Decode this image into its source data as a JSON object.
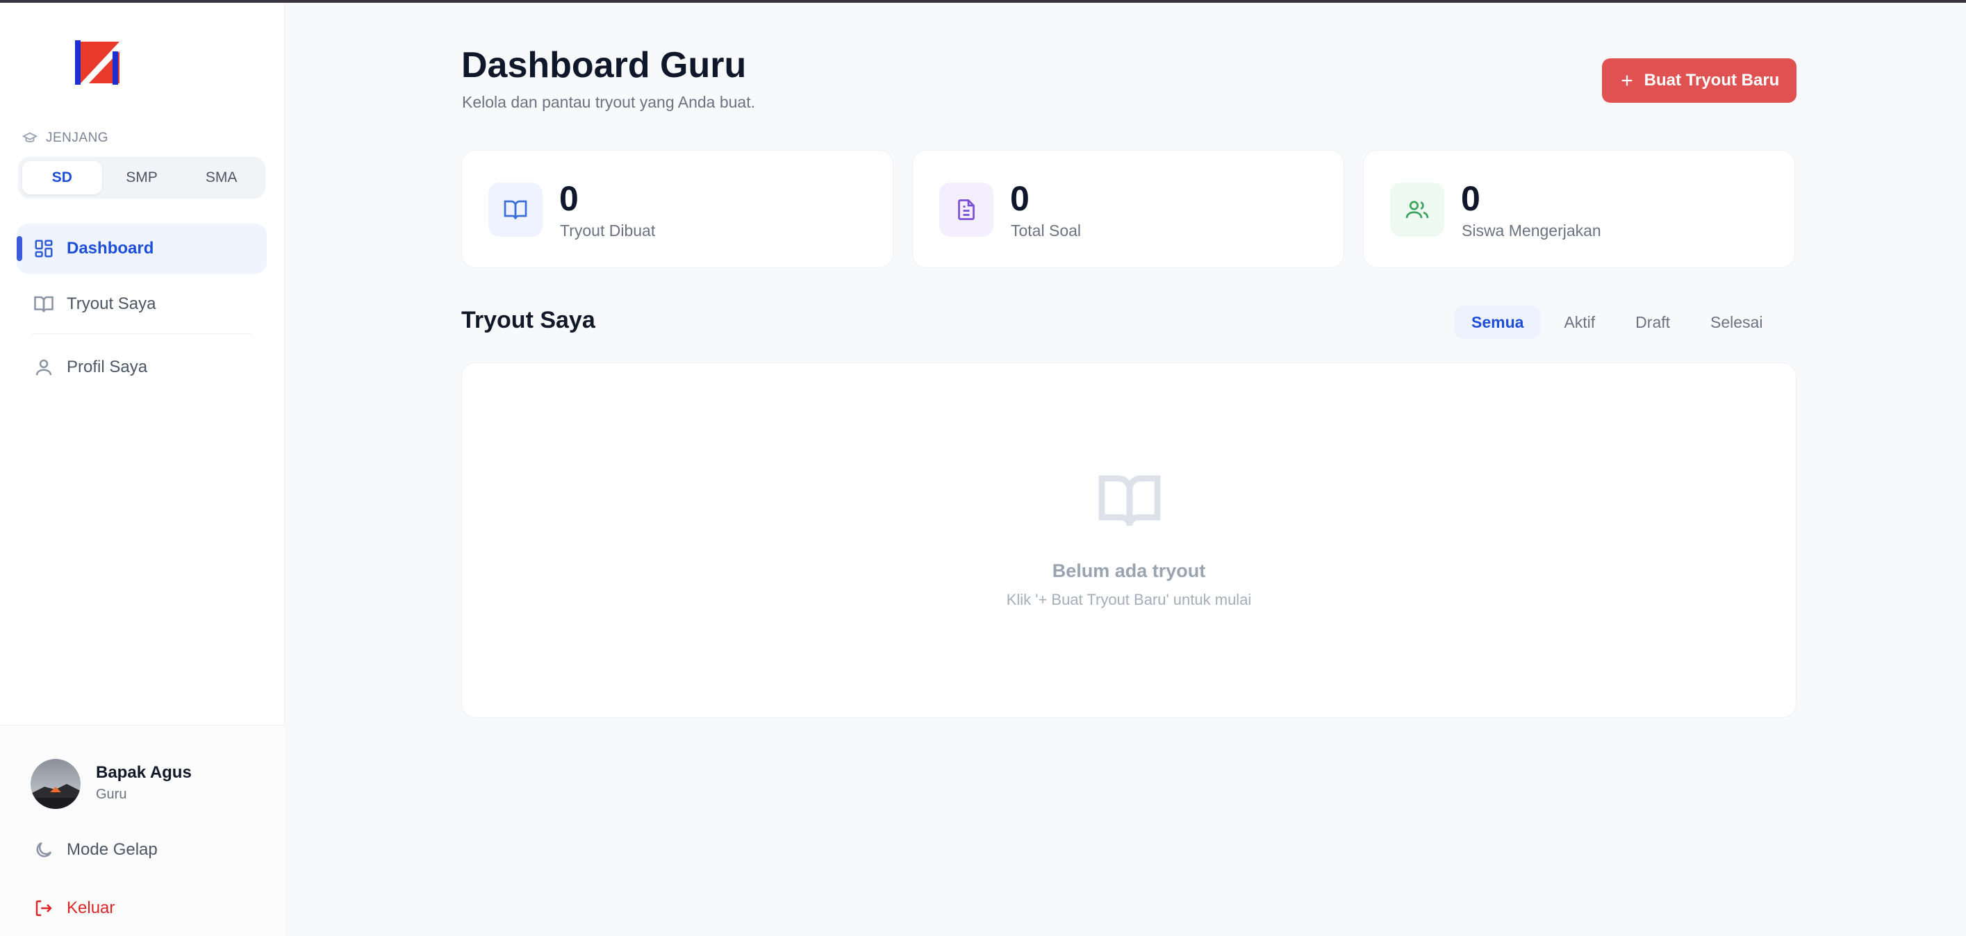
{
  "colors": {
    "accent": "#1d4ed8",
    "danger": "#e05252",
    "logo_red": "#e8392b",
    "logo_blue": "#1d2fd1"
  },
  "sidebar": {
    "logo_icon": "brand-logo",
    "level_label": "JENJANG",
    "levels": [
      {
        "label": "SD",
        "active": true
      },
      {
        "label": "SMP",
        "active": false
      },
      {
        "label": "SMA",
        "active": false
      }
    ],
    "nav": [
      {
        "label": "Dashboard",
        "icon": "grid-icon",
        "active": true
      },
      {
        "label": "Tryout Saya",
        "icon": "book-icon",
        "active": false
      },
      {
        "label": "Profil Saya",
        "icon": "user-icon",
        "active": false
      }
    ],
    "user": {
      "name": "Bapak Agus",
      "role": "Guru"
    },
    "dark_mode_label": "Mode Gelap",
    "logout_label": "Keluar"
  },
  "header": {
    "title": "Dashboard Guru",
    "subtitle": "Kelola dan pantau tryout yang Anda buat.",
    "create_button": "Buat Tryout Baru"
  },
  "stats": [
    {
      "value": "0",
      "label": "Tryout Dibuat",
      "icon": "book-icon"
    },
    {
      "value": "0",
      "label": "Total Soal",
      "icon": "document-icon"
    },
    {
      "value": "0",
      "label": "Siswa Mengerjakan",
      "icon": "users-icon"
    }
  ],
  "tryouts": {
    "title": "Tryout Saya",
    "filters": [
      {
        "label": "Semua",
        "active": true
      },
      {
        "label": "Aktif",
        "active": false
      },
      {
        "label": "Draft",
        "active": false
      },
      {
        "label": "Selesai",
        "active": false
      }
    ],
    "empty_title": "Belum ada tryout",
    "empty_hint": "Klik '+ Buat Tryout Baru' untuk mulai"
  }
}
